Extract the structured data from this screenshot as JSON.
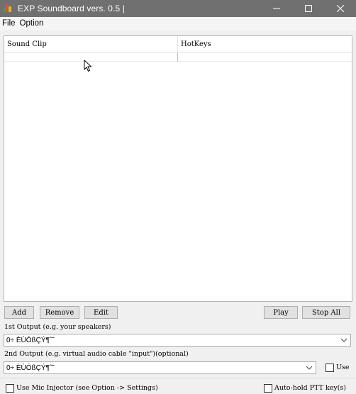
{
  "window": {
    "title": "EXP Soundboard vers. 0.5 |",
    "icon": "app-logo-icon",
    "controls": [
      "minimize-icon",
      "maximize-icon",
      "close-icon"
    ]
  },
  "menu": {
    "file": "File",
    "option": "Option"
  },
  "list": {
    "columns": [
      "Sound Clip",
      "HotKeys"
    ],
    "rows": []
  },
  "buttons": {
    "add": "Add",
    "remove": "Remove",
    "edit": "Edit",
    "play": "Play",
    "stop_all": "Stop All"
  },
  "output1": {
    "label": "1st Output (e.g. your speakers)",
    "value": "0÷ ÈÙÓßÇÝ¶ˆ˜"
  },
  "output2": {
    "label": "2nd Output (e.g. virtual audio cable \"input\")(optional)",
    "value": "0÷ ÈÙÓßÇÝ¶ˆ˜",
    "use_label": "Use",
    "use_checked": false
  },
  "footer": {
    "mic_injector_label": "Use Mic Injector (see Option -> Settings)",
    "mic_injector_checked": false,
    "ptt_label": "Auto-hold PTT key(s)",
    "ptt_checked": false
  },
  "colors": {
    "titlebar": "#707070",
    "window_bg": "#f0f0f0",
    "button_bg": "#e1e1e1"
  }
}
